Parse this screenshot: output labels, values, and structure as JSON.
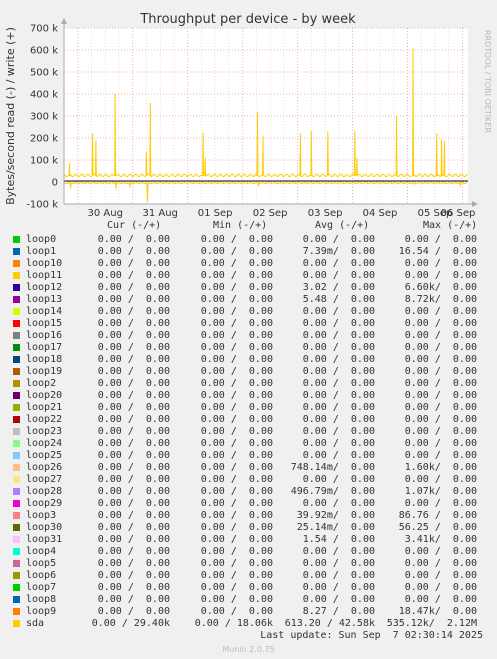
{
  "chart_data": {
    "type": "line",
    "title": "Throughput per device - by week",
    "ylabel": "Bytes/second read (-) / write (+)",
    "ylim": [
      -100000,
      700000
    ],
    "yticks": [
      -100000,
      0,
      100000,
      200000,
      300000,
      400000,
      500000,
      600000,
      700000
    ],
    "ytick_labels": [
      "-100 k",
      "0",
      "100 k",
      "200 k",
      "300 k",
      "400 k",
      "500 k",
      "600 k",
      "700 k"
    ],
    "x_range_days": [
      29.75,
      37.1
    ],
    "xticks": [
      {
        "label": "30 Aug",
        "day": 30.5
      },
      {
        "label": "31 Aug",
        "day": 31.5
      },
      {
        "label": "01 Sep",
        "day": 32.5
      },
      {
        "label": "02 Sep",
        "day": 33.5
      },
      {
        "label": "03 Sep",
        "day": 34.5
      },
      {
        "label": "04 Sep",
        "day": 35.5
      },
      {
        "label": "05 Sep",
        "day": 36.5
      },
      {
        "label": "06 Sep",
        "day": 37.5
      }
    ],
    "grid": true,
    "series": [
      {
        "name": "sda",
        "color": "#ffcc00",
        "write_spikes": [
          [
            29.85,
            85000
          ],
          [
            30.27,
            220000
          ],
          [
            30.33,
            190000
          ],
          [
            30.68,
            400000
          ],
          [
            31.25,
            140000
          ],
          [
            31.32,
            360000
          ],
          [
            32.28,
            225000
          ],
          [
            32.32,
            110000
          ],
          [
            33.27,
            320000
          ],
          [
            33.37,
            210000
          ],
          [
            34.05,
            220000
          ],
          [
            34.25,
            230000
          ],
          [
            34.55,
            230000
          ],
          [
            35.04,
            230000
          ],
          [
            35.08,
            110000
          ],
          [
            35.8,
            300000
          ],
          [
            36.1,
            610000
          ],
          [
            36.53,
            220000
          ],
          [
            36.62,
            195000
          ],
          [
            36.67,
            185000
          ]
        ],
        "read_spikes": [
          [
            29.87,
            -30000
          ],
          [
            30.7,
            -30000
          ],
          [
            30.95,
            -25000
          ],
          [
            31.27,
            -90000
          ],
          [
            33.29,
            -20000
          ],
          [
            36.12,
            -10000
          ],
          [
            36.96,
            -20000
          ]
        ],
        "baseline_write": 30000,
        "baseline_read": -5000
      }
    ],
    "legend_columns": [
      "Cur (-/+)",
      "Min (-/+)",
      "Avg (-/+)",
      "Max (-/+)"
    ]
  },
  "legend": [
    {
      "name": "loop0",
      "color": "#00cc00",
      "cur": "0.00 /  0.00",
      "min": "0.00 /  0.00",
      "avg": "0.00 /  0.00",
      "max": "0.00 /  0.00"
    },
    {
      "name": "loop1",
      "color": "#0066b3",
      "cur": "0.00 /  0.00",
      "min": "0.00 /  0.00",
      "avg": "7.39m/  0.00",
      "max": "16.54 /  0.00"
    },
    {
      "name": "loop10",
      "color": "#ff8000",
      "cur": "0.00 /  0.00",
      "min": "0.00 /  0.00",
      "avg": "0.00 /  0.00",
      "max": "0.00 /  0.00"
    },
    {
      "name": "loop11",
      "color": "#ffcc00",
      "cur": "0.00 /  0.00",
      "min": "0.00 /  0.00",
      "avg": "0.00 /  0.00",
      "max": "0.00 /  0.00"
    },
    {
      "name": "loop12",
      "color": "#330099",
      "cur": "0.00 /  0.00",
      "min": "0.00 /  0.00",
      "avg": "3.02 /  0.00",
      "max": "6.60k/  0.00"
    },
    {
      "name": "loop13",
      "color": "#990099",
      "cur": "0.00 /  0.00",
      "min": "0.00 /  0.00",
      "avg": "5.48 /  0.00",
      "max": "8.72k/  0.00"
    },
    {
      "name": "loop14",
      "color": "#ccff00",
      "cur": "0.00 /  0.00",
      "min": "0.00 /  0.00",
      "avg": "0.00 /  0.00",
      "max": "0.00 /  0.00"
    },
    {
      "name": "loop15",
      "color": "#ff0000",
      "cur": "0.00 /  0.00",
      "min": "0.00 /  0.00",
      "avg": "0.00 /  0.00",
      "max": "0.00 /  0.00"
    },
    {
      "name": "loop16",
      "color": "#808080",
      "cur": "0.00 /  0.00",
      "min": "0.00 /  0.00",
      "avg": "0.00 /  0.00",
      "max": "0.00 /  0.00"
    },
    {
      "name": "loop17",
      "color": "#008f00",
      "cur": "0.00 /  0.00",
      "min": "0.00 /  0.00",
      "avg": "0.00 /  0.00",
      "max": "0.00 /  0.00"
    },
    {
      "name": "loop18",
      "color": "#00487d",
      "cur": "0.00 /  0.00",
      "min": "0.00 /  0.00",
      "avg": "0.00 /  0.00",
      "max": "0.00 /  0.00"
    },
    {
      "name": "loop19",
      "color": "#b35a00",
      "cur": "0.00 /  0.00",
      "min": "0.00 /  0.00",
      "avg": "0.00 /  0.00",
      "max": "0.00 /  0.00"
    },
    {
      "name": "loop2",
      "color": "#b38f00",
      "cur": "0.00 /  0.00",
      "min": "0.00 /  0.00",
      "avg": "0.00 /  0.00",
      "max": "0.00 /  0.00"
    },
    {
      "name": "loop20",
      "color": "#6b006b",
      "cur": "0.00 /  0.00",
      "min": "0.00 /  0.00",
      "avg": "0.00 /  0.00",
      "max": "0.00 /  0.00"
    },
    {
      "name": "loop21",
      "color": "#8fb300",
      "cur": "0.00 /  0.00",
      "min": "0.00 /  0.00",
      "avg": "0.00 /  0.00",
      "max": "0.00 /  0.00"
    },
    {
      "name": "loop22",
      "color": "#b30000",
      "cur": "0.00 /  0.00",
      "min": "0.00 /  0.00",
      "avg": "0.00 /  0.00",
      "max": "0.00 /  0.00"
    },
    {
      "name": "loop23",
      "color": "#bebebe",
      "cur": "0.00 /  0.00",
      "min": "0.00 /  0.00",
      "avg": "0.00 /  0.00",
      "max": "0.00 /  0.00"
    },
    {
      "name": "loop24",
      "color": "#80ff80",
      "cur": "0.00 /  0.00",
      "min": "0.00 /  0.00",
      "avg": "0.00 /  0.00",
      "max": "0.00 /  0.00"
    },
    {
      "name": "loop25",
      "color": "#80c9ff",
      "cur": "0.00 /  0.00",
      "min": "0.00 /  0.00",
      "avg": "0.00 /  0.00",
      "max": "0.00 /  0.00"
    },
    {
      "name": "loop26",
      "color": "#ffc080",
      "cur": "0.00 /  0.00",
      "min": "0.00 /  0.00",
      "avg": "748.14m/  0.00",
      "max": "1.60k/  0.00"
    },
    {
      "name": "loop27",
      "color": "#ffe680",
      "cur": "0.00 /  0.00",
      "min": "0.00 /  0.00",
      "avg": "0.00 /  0.00",
      "max": "0.00 /  0.00"
    },
    {
      "name": "loop28",
      "color": "#aa80ff",
      "cur": "0.00 /  0.00",
      "min": "0.00 /  0.00",
      "avg": "496.79m/  0.00",
      "max": "1.07k/  0.00"
    },
    {
      "name": "loop29",
      "color": "#ee00cc",
      "cur": "0.00 /  0.00",
      "min": "0.00 /  0.00",
      "avg": "0.00 /  0.00",
      "max": "0.00 /  0.00"
    },
    {
      "name": "loop3",
      "color": "#ff8080",
      "cur": "0.00 /  0.00",
      "min": "0.00 /  0.00",
      "avg": "39.92m/  0.00",
      "max": "86.76 /  0.00"
    },
    {
      "name": "loop30",
      "color": "#666600",
      "cur": "0.00 /  0.00",
      "min": "0.00 /  0.00",
      "avg": "25.14m/  0.00",
      "max": "56.25 /  0.00"
    },
    {
      "name": "loop31",
      "color": "#ffbfff",
      "cur": "0.00 /  0.00",
      "min": "0.00 /  0.00",
      "avg": "1.54 /  0.00",
      "max": "3.41k/  0.00"
    },
    {
      "name": "loop4",
      "color": "#00ffcc",
      "cur": "0.00 /  0.00",
      "min": "0.00 /  0.00",
      "avg": "0.00 /  0.00",
      "max": "0.00 /  0.00"
    },
    {
      "name": "loop5",
      "color": "#cc6699",
      "cur": "0.00 /  0.00",
      "min": "0.00 /  0.00",
      "avg": "0.00 /  0.00",
      "max": "0.00 /  0.00"
    },
    {
      "name": "loop6",
      "color": "#999900",
      "cur": "0.00 /  0.00",
      "min": "0.00 /  0.00",
      "avg": "0.00 /  0.00",
      "max": "0.00 /  0.00"
    },
    {
      "name": "loop7",
      "color": "#00cc00",
      "cur": "0.00 /  0.00",
      "min": "0.00 /  0.00",
      "avg": "0.00 /  0.00",
      "max": "0.00 /  0.00"
    },
    {
      "name": "loop8",
      "color": "#0066b3",
      "cur": "0.00 /  0.00",
      "min": "0.00 /  0.00",
      "avg": "0.00 /  0.00",
      "max": "0.00 /  0.00"
    },
    {
      "name": "loop9",
      "color": "#ff8000",
      "cur": "0.00 /  0.00",
      "min": "0.00 /  0.00",
      "avg": "8.27 /  0.00",
      "max": "18.47k/  0.00"
    },
    {
      "name": "sda",
      "color": "#ffcc00",
      "cur": "0.00 / 29.40k",
      "min": "0.00 / 18.06k",
      "avg": "613.20 / 42.58k",
      "max": "535.12k/  2.12M"
    }
  ],
  "last_update": "Last update: Sun Sep  7 02:30:14 2025",
  "side_label": "RRDTOOL / TOBI OETIKER",
  "footer": "Munin 2.0.75"
}
